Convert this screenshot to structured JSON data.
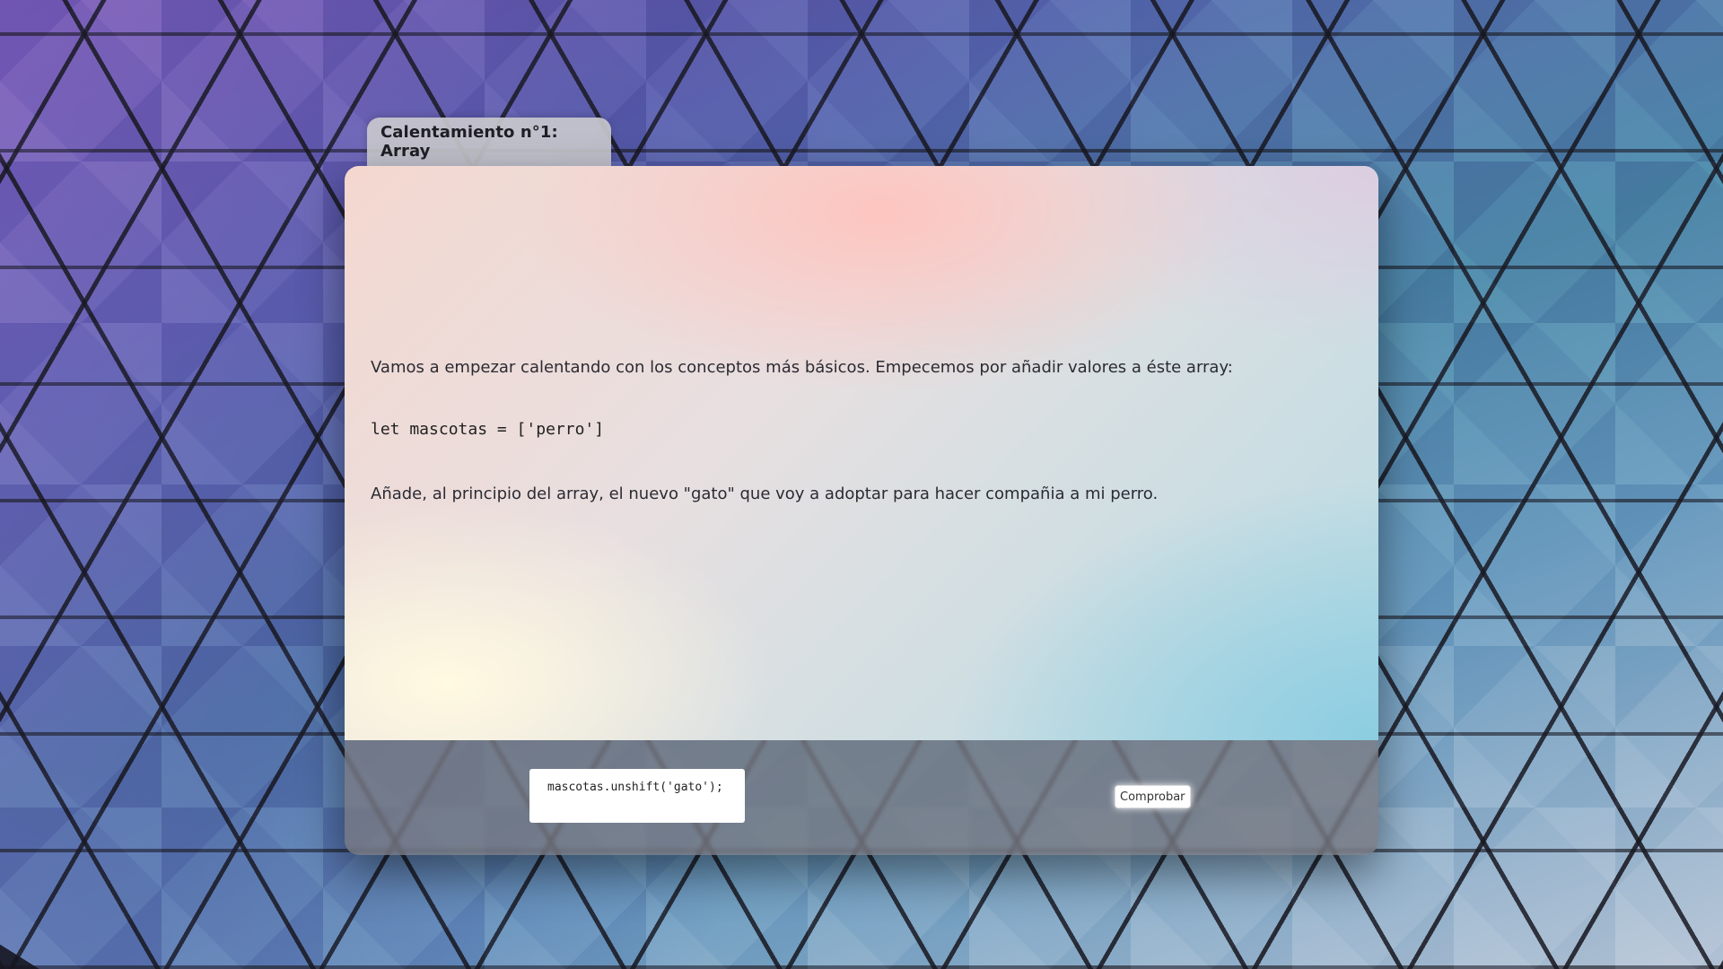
{
  "exercise": {
    "tab_title": "Calentamiento n°1: Array",
    "intro": "Vamos a empezar calentando con los conceptos más básicos. Empecemos por añadir valores a éste array:",
    "code": "let mascotas = ['perro']",
    "instruction": "Añade, al principio del array, el nuevo \"gato\" que voy a adoptar para hacer compañia a mi perro."
  },
  "answer": {
    "value": "mascotas.unshift('gato');"
  },
  "actions": {
    "check_label": "Comprobar"
  }
}
